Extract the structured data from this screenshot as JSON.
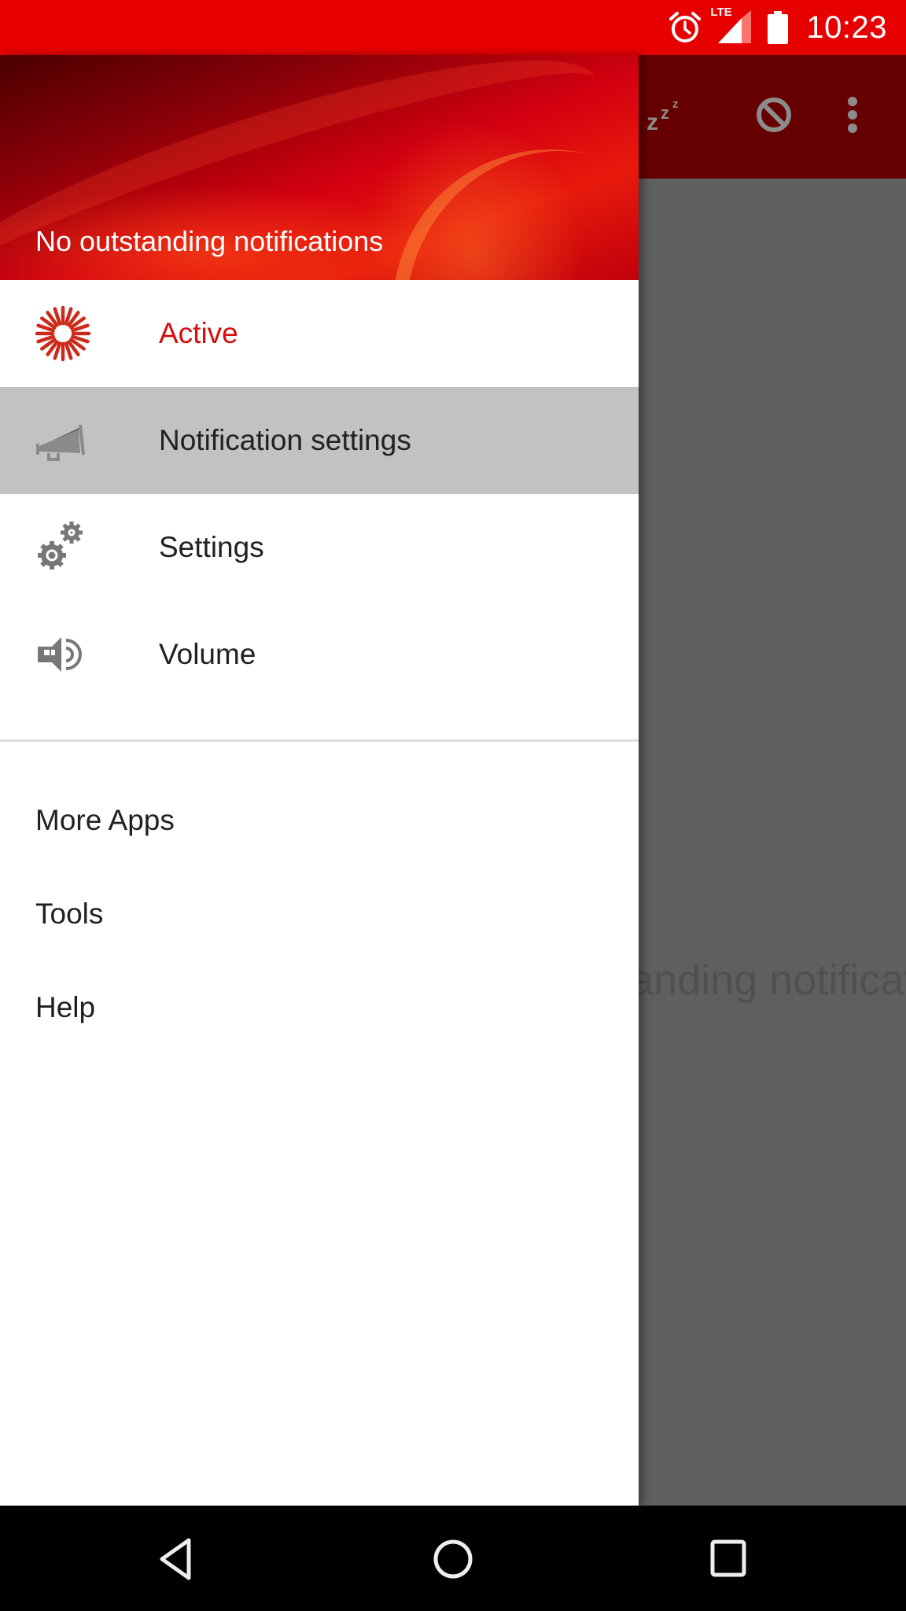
{
  "status_bar": {
    "time": "10:23",
    "network_label": "LTE",
    "icons": [
      "alarm-icon",
      "lte-signal-icon",
      "battery-icon"
    ]
  },
  "background_app": {
    "toolbar_actions": [
      {
        "name": "snooze",
        "icon": "snooze-icon",
        "glyph": "zzz"
      },
      {
        "name": "block",
        "icon": "block-icon"
      },
      {
        "name": "overflow",
        "icon": "more-vert-icon"
      }
    ],
    "empty_state_text": "No outstanding notifications"
  },
  "drawer": {
    "header_title": "No outstanding notifications",
    "primary_items": [
      {
        "label": "Active",
        "icon": "active-sunburst-icon",
        "state": "active"
      },
      {
        "label": "Notification settings",
        "icon": "megaphone-icon",
        "state": "pressed"
      },
      {
        "label": "Settings",
        "icon": "gears-icon",
        "state": "normal"
      },
      {
        "label": "Volume",
        "icon": "speaker-volume-icon",
        "state": "normal"
      }
    ],
    "secondary_items": [
      {
        "label": "More Apps"
      },
      {
        "label": "Tools"
      },
      {
        "label": "Help"
      }
    ]
  },
  "navigation_bar": {
    "buttons": [
      "back",
      "home",
      "recents"
    ]
  },
  "colors": {
    "accent": "#e60000",
    "active_label": "#d50d0d",
    "selected_row": "#c2c2c2",
    "icon_gray": "#757575",
    "scrim": "#5f5f5f"
  }
}
